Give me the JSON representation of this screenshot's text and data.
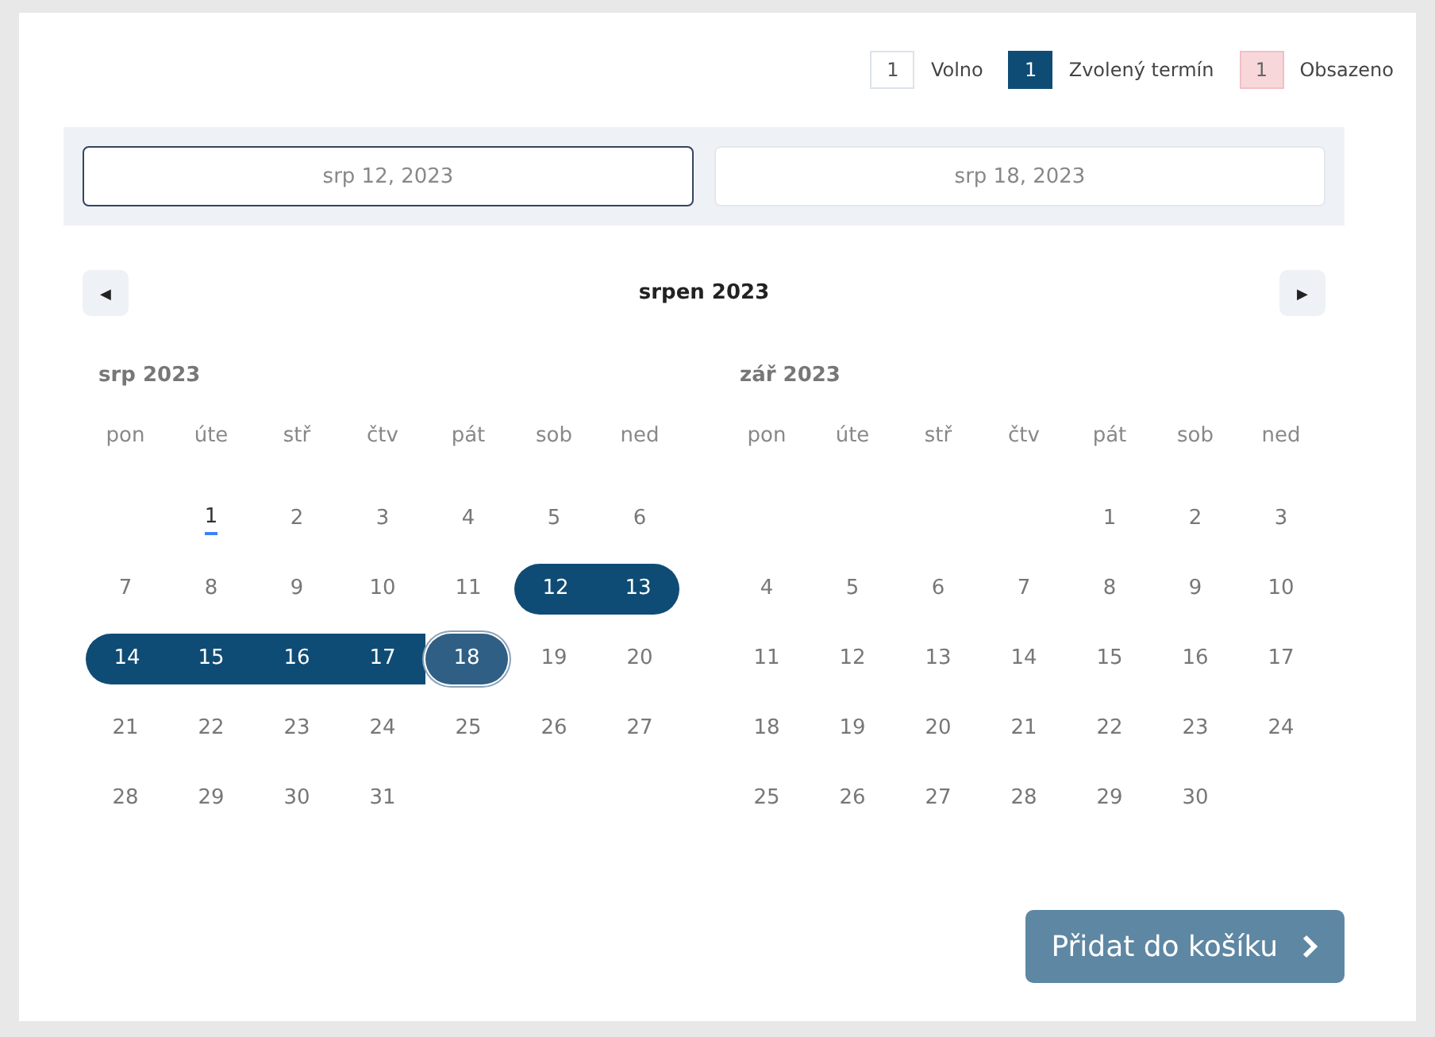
{
  "legend": [
    {
      "kind": "free",
      "number": "1",
      "label": "Volno"
    },
    {
      "kind": "chosen",
      "number": "1",
      "label": "Zvolený termín"
    },
    {
      "kind": "occupied",
      "number": "1",
      "label": "Obsazeno"
    }
  ],
  "date_fields": [
    {
      "value": "srp 12, 2023",
      "focused": true
    },
    {
      "value": "srp 18, 2023",
      "focused": false
    }
  ],
  "navigation": {
    "prev_icon": "◀",
    "title": "srpen 2023",
    "next_icon": "▶"
  },
  "months": [
    {
      "title": "srp 2023",
      "weekdays": [
        "pon",
        "úte",
        "stř",
        "čtv",
        "pát",
        "sob",
        "ned"
      ],
      "weeks": [
        {
          "kind": "first",
          "days": [
            {
              "label": "1",
              "selected": false,
              "today": true,
              "focused": false
            },
            {
              "label": "2",
              "selected": false,
              "today": false,
              "focused": false
            },
            {
              "label": "3",
              "selected": false,
              "today": false,
              "focused": false
            },
            {
              "label": "4",
              "selected": false,
              "today": false,
              "focused": false
            },
            {
              "label": "5",
              "selected": false,
              "today": false,
              "focused": false
            },
            {
              "label": "6",
              "selected": false,
              "today": false,
              "focused": false
            }
          ]
        },
        {
          "kind": "regular",
          "days": [
            {
              "label": "7",
              "selected": false,
              "today": false,
              "focused": false
            },
            {
              "label": "8",
              "selected": false,
              "today": false,
              "focused": false
            },
            {
              "label": "9",
              "selected": false,
              "today": false,
              "focused": false
            },
            {
              "label": "10",
              "selected": false,
              "today": false,
              "focused": false
            },
            {
              "label": "11",
              "selected": false,
              "today": false,
              "focused": false
            },
            {
              "label": "12",
              "selected": true,
              "today": false,
              "focused": false
            },
            {
              "label": "13",
              "selected": true,
              "today": false,
              "focused": false
            }
          ]
        },
        {
          "kind": "regular",
          "days": [
            {
              "label": "14",
              "selected": true,
              "today": false,
              "focused": false
            },
            {
              "label": "15",
              "selected": true,
              "today": false,
              "focused": false
            },
            {
              "label": "16",
              "selected": true,
              "today": false,
              "focused": false
            },
            {
              "label": "17",
              "selected": true,
              "today": false,
              "focused": false
            },
            {
              "label": "18",
              "selected": true,
              "today": false,
              "focused": true
            },
            {
              "label": "19",
              "selected": false,
              "today": false,
              "focused": false
            },
            {
              "label": "20",
              "selected": false,
              "today": false,
              "focused": false
            }
          ]
        },
        {
          "kind": "regular",
          "days": [
            {
              "label": "21",
              "selected": false,
              "today": false,
              "focused": false
            },
            {
              "label": "22",
              "selected": false,
              "today": false,
              "focused": false
            },
            {
              "label": "23",
              "selected": false,
              "today": false,
              "focused": false
            },
            {
              "label": "24",
              "selected": false,
              "today": false,
              "focused": false
            },
            {
              "label": "25",
              "selected": false,
              "today": false,
              "focused": false
            },
            {
              "label": "26",
              "selected": false,
              "today": false,
              "focused": false
            },
            {
              "label": "27",
              "selected": false,
              "today": false,
              "focused": false
            }
          ]
        },
        {
          "kind": "regular",
          "days": [
            {
              "label": "28",
              "selected": false,
              "today": false,
              "focused": false
            },
            {
              "label": "29",
              "selected": false,
              "today": false,
              "focused": false
            },
            {
              "label": "30",
              "selected": false,
              "today": false,
              "focused": false
            },
            {
              "label": "31",
              "selected": false,
              "today": false,
              "focused": false
            }
          ]
        }
      ]
    },
    {
      "title": "zář 2023",
      "weekdays": [
        "pon",
        "úte",
        "stř",
        "čtv",
        "pát",
        "sob",
        "ned"
      ],
      "weeks": [
        {
          "kind": "first",
          "days": [
            {
              "label": "1",
              "selected": false,
              "today": false,
              "focused": false
            },
            {
              "label": "2",
              "selected": false,
              "today": false,
              "focused": false
            },
            {
              "label": "3",
              "selected": false,
              "today": false,
              "focused": false
            }
          ]
        },
        {
          "kind": "regular",
          "days": [
            {
              "label": "4",
              "selected": false,
              "today": false,
              "focused": false
            },
            {
              "label": "5",
              "selected": false,
              "today": false,
              "focused": false
            },
            {
              "label": "6",
              "selected": false,
              "today": false,
              "focused": false
            },
            {
              "label": "7",
              "selected": false,
              "today": false,
              "focused": false
            },
            {
              "label": "8",
              "selected": false,
              "today": false,
              "focused": false
            },
            {
              "label": "9",
              "selected": false,
              "today": false,
              "focused": false
            },
            {
              "label": "10",
              "selected": false,
              "today": false,
              "focused": false
            }
          ]
        },
        {
          "kind": "regular",
          "days": [
            {
              "label": "11",
              "selected": false,
              "today": false,
              "focused": false
            },
            {
              "label": "12",
              "selected": false,
              "today": false,
              "focused": false
            },
            {
              "label": "13",
              "selected": false,
              "today": false,
              "focused": false
            },
            {
              "label": "14",
              "selected": false,
              "today": false,
              "focused": false
            },
            {
              "label": "15",
              "selected": false,
              "today": false,
              "focused": false
            },
            {
              "label": "16",
              "selected": false,
              "today": false,
              "focused": false
            },
            {
              "label": "17",
              "selected": false,
              "today": false,
              "focused": false
            }
          ]
        },
        {
          "kind": "regular",
          "days": [
            {
              "label": "18",
              "selected": false,
              "today": false,
              "focused": false
            },
            {
              "label": "19",
              "selected": false,
              "today": false,
              "focused": false
            },
            {
              "label": "20",
              "selected": false,
              "today": false,
              "focused": false
            },
            {
              "label": "21",
              "selected": false,
              "today": false,
              "focused": false
            },
            {
              "label": "22",
              "selected": false,
              "today": false,
              "focused": false
            },
            {
              "label": "23",
              "selected": false,
              "today": false,
              "focused": false
            },
            {
              "label": "24",
              "selected": false,
              "today": false,
              "focused": false
            }
          ]
        },
        {
          "kind": "regular",
          "days": [
            {
              "label": "25",
              "selected": false,
              "today": false,
              "focused": false
            },
            {
              "label": "26",
              "selected": false,
              "today": false,
              "focused": false
            },
            {
              "label": "27",
              "selected": false,
              "today": false,
              "focused": false
            },
            {
              "label": "28",
              "selected": false,
              "today": false,
              "focused": false
            },
            {
              "label": "29",
              "selected": false,
              "today": false,
              "focused": false
            },
            {
              "label": "30",
              "selected": false,
              "today": false,
              "focused": false
            }
          ]
        }
      ]
    }
  ],
  "add_button": {
    "label": "Přidat do košíku",
    "disabled": true
  }
}
